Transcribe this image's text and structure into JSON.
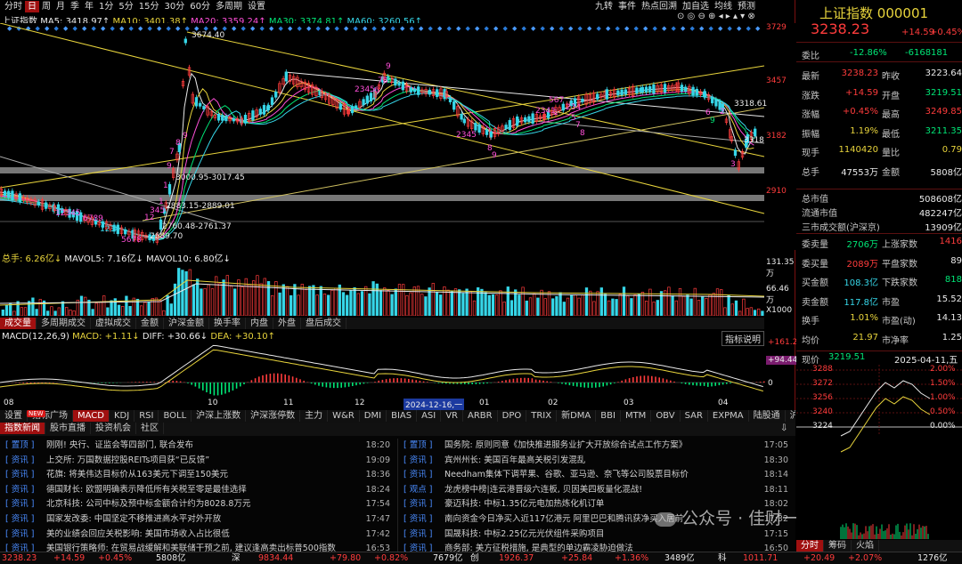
{
  "periods": [
    "分时",
    "日",
    "周",
    "月",
    "季",
    "年",
    "1分",
    "5分",
    "15分",
    "30分",
    "60分",
    "多周期",
    "设置"
  ],
  "period_selected": "日",
  "top_tools": [
    "九转",
    "事件",
    "热点回溯",
    "加自选",
    "均线",
    "预测"
  ],
  "ma_line": {
    "prefix": "上证指数",
    "ma5": "MA5: 3418.97↑",
    "ma10": "MA10: 3401.38↑",
    "ma20": "MA20: 3359.24↑",
    "ma30": "MA30: 3374.81↑",
    "ma60": "MA60: 3260.56↑"
  },
  "chart_type_label": "日线",
  "price_axis": [
    "3729",
    "3457",
    "3182",
    "2910"
  ],
  "annotations": {
    "high": "3674.40",
    "low": "2689.70",
    "band1": "3000.95-3017.45",
    "band2": "2883.15-2889.01",
    "band3": "2760.48-2761.37",
    "right1": "3318.61",
    "right2": "3318"
  },
  "nine_turn_marks": [
    {
      "t": "12345",
      "c": "pk"
    },
    {
      "t": "6789",
      "c": "pk"
    },
    {
      "t": "1234",
      "c": "cy"
    },
    {
      "t": "5678",
      "c": "pk"
    },
    {
      "t": "9",
      "c": "pk"
    },
    {
      "t": "2345",
      "c": "pk"
    },
    {
      "t": "6",
      "c": "pk"
    },
    {
      "t": "78",
      "c": "pk"
    },
    {
      "t": "9",
      "c": "dn"
    },
    {
      "t": "2345",
      "c": "pk"
    },
    {
      "t": "8",
      "c": "pk"
    },
    {
      "t": "9",
      "c": "pk"
    },
    {
      "t": "567",
      "c": "pk"
    },
    {
      "t": "2341",
      "c": "pk"
    },
    {
      "t": "1",
      "c": "pk"
    },
    {
      "t": "234",
      "c": "pk"
    },
    {
      "t": "5",
      "c": "pk"
    },
    {
      "t": "7",
      "c": "pk"
    },
    {
      "t": "8",
      "c": "pk"
    },
    {
      "t": "6",
      "c": "pk"
    },
    {
      "t": "9",
      "c": "dn"
    },
    {
      "t": "1",
      "c": "pk"
    },
    {
      "t": "12",
      "c": "pk"
    },
    {
      "t": "345",
      "c": "pk"
    },
    {
      "t": "9",
      "c": "pk"
    },
    {
      "t": "1",
      "c": "pk"
    },
    {
      "t": "7",
      "c": "pk"
    },
    {
      "t": "8",
      "c": "pk"
    },
    {
      "t": "9",
      "c": "pk"
    },
    {
      "t": "3",
      "c": "pk"
    },
    {
      "t": "2",
      "c": "pk"
    }
  ],
  "volume_line": {
    "total": "总手: 6.26亿↓",
    "mavol5": "MAVOL5: 7.16亿↓",
    "mavol10": "MAVOL10: 6.80亿↓"
  },
  "volume_axis": [
    "131.35万",
    "66.46万",
    "X1000"
  ],
  "indicator_tabs": [
    "成交量",
    "多周期成交",
    "虚拟成交",
    "金额",
    "沪深金额",
    "换手率",
    "内盘",
    "外盘",
    "盘后成交"
  ],
  "indicator_selected": "成交量",
  "macd_line": {
    "label": "MACD(12,26,9)",
    "macd": "MACD: +1.11↓",
    "diff": "DIFF: +30.66↓",
    "dea": "DEA: +30.10↑"
  },
  "macd_axis": [
    "+161.2",
    "+94.44",
    "0"
  ],
  "indicator_explain": "指标说明",
  "date_axis": [
    "08",
    "10",
    "11",
    "12",
    "01",
    "02",
    "03",
    "04"
  ],
  "date_highlight": "2024-12-16,一",
  "bottom_tabs": [
    "设置",
    "指标广场",
    "MACD",
    "KDJ",
    "RSI",
    "BOLL",
    "沪深上涨数",
    "沪深涨停数",
    "主力",
    "W&R",
    "DMI",
    "BIAS",
    "ASI",
    "VR",
    "ARBR",
    "DPO",
    "TRIX",
    "新DMA",
    "BBI",
    "MTM",
    "OBV",
    "SAR",
    "EXPMA",
    "陆股通",
    "沪股通"
  ],
  "bottom_selected": "MACD",
  "new_badge": "NEW",
  "news_tabs": [
    "指数新闻",
    "股市直播",
    "投资机会",
    "社区"
  ],
  "news_left": [
    {
      "tag": "置顶",
      "title": "刚刚! 央行、证监会等四部门, 联合发布",
      "time": "18:20"
    },
    {
      "tag": "资讯",
      "title": "上交所: 万国数据控股REITs项目获“已反馈”",
      "time": "19:09"
    },
    {
      "tag": "资讯",
      "title": "花旗: 将美伟达目标价从163美元下调至150美元",
      "time": "18:36"
    },
    {
      "tag": "资讯",
      "title": "德国财长: 欧盟明确表示降低所有关税至零是最佳选择",
      "time": "18:24"
    },
    {
      "tag": "资讯",
      "title": "北京科技: 公司中标及预中标金额合计约为8028.8万元",
      "time": "17:54"
    },
    {
      "tag": "资讯",
      "title": "国家发改委: 中国坚定不移推进高水平对外开放",
      "time": "17:47"
    },
    {
      "tag": "资讯",
      "title": "美的业绩会回应关税影响: 美国市场收入占比很低",
      "time": "17:42"
    },
    {
      "tag": "资讯",
      "title": "美国银行策略师: 在贸易战缓解和美联储干预之前, 建议逢高卖出标普500指数",
      "time": "16:53"
    }
  ],
  "news_right": [
    {
      "tag": "置顶",
      "title": "国务院: 原则同意《加快推进服务业扩大开放综合试点工作方案》",
      "time": "17:05"
    },
    {
      "tag": "资讯",
      "title": "宾州州长: 美国百年最高关税引发混乱",
      "time": "18:30"
    },
    {
      "tag": "资讯",
      "title": "Needham集体下调苹果、谷歌、亚马逊、奈飞等公司股票目标价",
      "time": "18:14"
    },
    {
      "tag": "观点",
      "title": "龙虎榜中榜|连云港晋级六连板, 贝因美四板量化混战!",
      "time": "18:11"
    },
    {
      "tag": "资讯",
      "title": "豪迈科技: 中标1.35亿元电加热炼化机订单",
      "time": "18:02"
    },
    {
      "tag": "资讯",
      "title": "南向资金今日净买入近117亿港元 阿里巴巴和腾讯获净买入居前",
      "time": "17:32"
    },
    {
      "tag": "资讯",
      "title": "国晟科技: 中标2.25亿元光伏组件采购项目",
      "time": "17:15"
    },
    {
      "tag": "资讯",
      "title": "商务部: 美方征税措施, 是典型的单边霸凌胁迫做法",
      "time": "16:50"
    }
  ],
  "quote": {
    "name": "上证指数",
    "code": "000001",
    "price": "3238.23",
    "change": "+14.59",
    "pct": "+0.45%",
    "weibi_label": "委比",
    "weibi": "-12.86%",
    "weicha": "-6168181",
    "rows": [
      {
        "l1": "最新",
        "v1": "3238.23",
        "c1": "up",
        "l2": "昨收",
        "v2": "3223.64",
        "c2": "wh"
      },
      {
        "l1": "涨跌",
        "v1": "+14.59",
        "c1": "up",
        "l2": "开盘",
        "v2": "3219.51",
        "c2": "dn"
      },
      {
        "l1": "涨幅",
        "v1": "+0.45%",
        "c1": "up",
        "l2": "最高",
        "v2": "3249.85",
        "c2": "up"
      },
      {
        "l1": "振幅",
        "v1": "1.19%",
        "c1": "yl",
        "l2": "最低",
        "v2": "3211.35",
        "c2": "dn"
      },
      {
        "l1": "现手",
        "v1": "1140420",
        "c1": "yl",
        "l2": "量比",
        "v2": "0.79",
        "c2": "yl"
      },
      {
        "l1": "总手",
        "v1": "47553万",
        "c1": "wh",
        "l2": "金额",
        "v2": "5808亿",
        "c2": "wh"
      }
    ],
    "cap": [
      {
        "l": "总市值",
        "v": "508608亿"
      },
      {
        "l": "流通市值",
        "v": "482247亿"
      },
      {
        "l": "三市成交额(沪深京)",
        "v": "13909亿"
      }
    ],
    "rows2": [
      {
        "l1": "委卖量",
        "v1": "2706万",
        "c1": "dn",
        "l2": "上涨家数",
        "v2": "1416",
        "c2": "up"
      },
      {
        "l1": "委买量",
        "v1": "2089万",
        "c1": "up",
        "l2": "平盘家数",
        "v2": "89",
        "c2": "wh"
      },
      {
        "l1": "买金额",
        "v1": "108.3亿",
        "c1": "cy",
        "l2": "下跌家数",
        "v2": "818",
        "c2": "dn"
      },
      {
        "l1": "卖金额",
        "v1": "117.8亿",
        "c1": "cy",
        "l2": "市盈",
        "v2": "15.52",
        "c2": "wh"
      },
      {
        "l1": "换手",
        "v1": "1.01%",
        "c1": "yl",
        "l2": "市盈(动)",
        "v2": "14.13",
        "c2": "wh"
      },
      {
        "l1": "均价",
        "v1": "21.97",
        "c1": "yl",
        "l2": "市净率",
        "v2": "1.25",
        "c2": "wh"
      }
    ],
    "now_label": "现价",
    "now_price": "3219.51",
    "date": "2025-04-11,五",
    "intraday_left": [
      "3288",
      "3272",
      "3256",
      "3240",
      "3224"
    ],
    "intraday_right": [
      "2.00%",
      "1.50%",
      "1.00%",
      "0.50%",
      "0.00%"
    ],
    "tabs": [
      "分时",
      "筹码",
      "火焰"
    ],
    "tab_selected": "分时"
  },
  "status_bar": [
    {
      "t": "3238.23",
      "c": "up"
    },
    {
      "t": "+14.59",
      "c": "up"
    },
    {
      "t": "+0.45%",
      "c": "up"
    },
    {
      "t": "5808亿",
      "c": "wh"
    },
    {
      "t": "深",
      "c": "wh"
    },
    {
      "t": "9834.44",
      "c": "up"
    },
    {
      "t": "+79.80",
      "c": "up"
    },
    {
      "t": "+0.82%",
      "c": "up"
    },
    {
      "t": "7679亿",
      "c": "wh"
    },
    {
      "t": "创",
      "c": "wh"
    },
    {
      "t": "1926.37",
      "c": "up"
    },
    {
      "t": "+25.84",
      "c": "up"
    },
    {
      "t": "+1.36%",
      "c": "up"
    },
    {
      "t": "3489亿",
      "c": "wh"
    },
    {
      "t": "科",
      "c": "wh"
    },
    {
      "t": "1011.71",
      "c": "up"
    },
    {
      "t": "+20.49",
      "c": "up"
    },
    {
      "t": "+2.07%",
      "c": "up"
    },
    {
      "t": "1276亿",
      "c": "wh"
    }
  ],
  "watermark": "公众号 · 佳财一分钟"
}
